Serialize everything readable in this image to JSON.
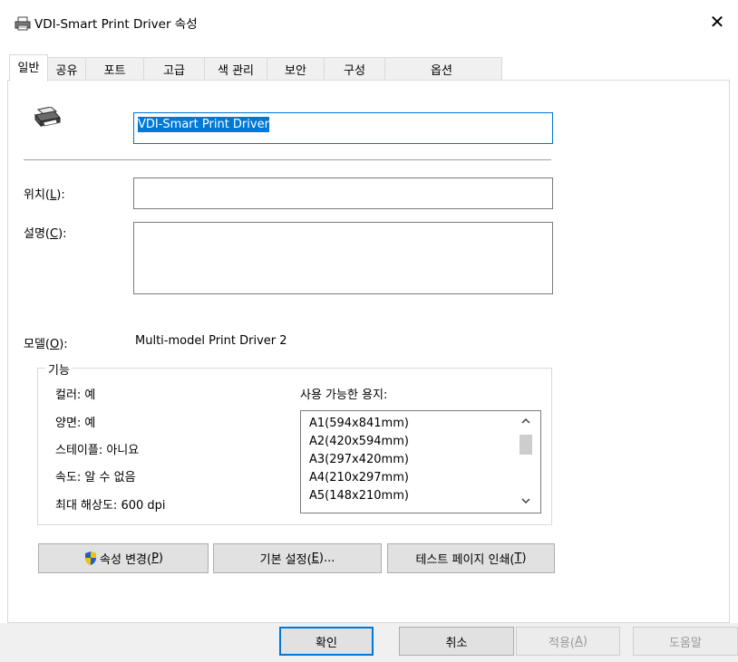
{
  "window": {
    "title": "VDI-Smart Print Driver 속성",
    "close_glyph": "✕"
  },
  "tabs": [
    {
      "label": "일반",
      "active": true
    },
    {
      "label": "공유"
    },
    {
      "label": "포트"
    },
    {
      "label": "고급"
    },
    {
      "label": "색 관리"
    },
    {
      "label": "보안"
    },
    {
      "label": "구성"
    },
    {
      "label": "옵션"
    }
  ],
  "general": {
    "printer_name": "VDI-Smart Print Driver",
    "location_label_pre": "위치(",
    "location_label_key": "L",
    "location_label_post": "):",
    "location_value": "",
    "comment_label_pre": "설명(",
    "comment_label_key": "C",
    "comment_label_post": "):",
    "comment_value": "",
    "model_label_pre": "모델(",
    "model_label_key": "O",
    "model_label_post": "):",
    "model_value": "Multi-model Print Driver 2"
  },
  "features": {
    "title": "기능",
    "color": "컬러: 예",
    "duplex": "양면: 예",
    "staple": "스테이플: 아니요",
    "speed": "속도: 알 수 없음",
    "max_resolution": "최대 해상도: 600 dpi",
    "paper_label": "사용 가능한 용지:",
    "paper_sizes": [
      "A1(594x841mm)",
      "A2(420x594mm)",
      "A3(297x420mm)",
      "A4(210x297mm)",
      "A5(148x210mm)"
    ]
  },
  "buttons": {
    "change_props_pre": "속성 변경(",
    "change_props_key": "P",
    "change_props_post": ")",
    "preferences_pre": "기본 설정(",
    "preferences_key": "E",
    "preferences_post": ")...",
    "test_page_pre": "테스트 페이지 인쇄(",
    "test_page_key": "T",
    "test_page_post": ")"
  },
  "footer": {
    "ok": "확인",
    "cancel": "취소",
    "apply_pre": "적용(",
    "apply_key": "A",
    "apply_post": ")",
    "help": "도움말"
  },
  "colors": {
    "accent": "#0078d7",
    "shield_blue": "#1e5fc8",
    "shield_yellow": "#f2c300"
  }
}
